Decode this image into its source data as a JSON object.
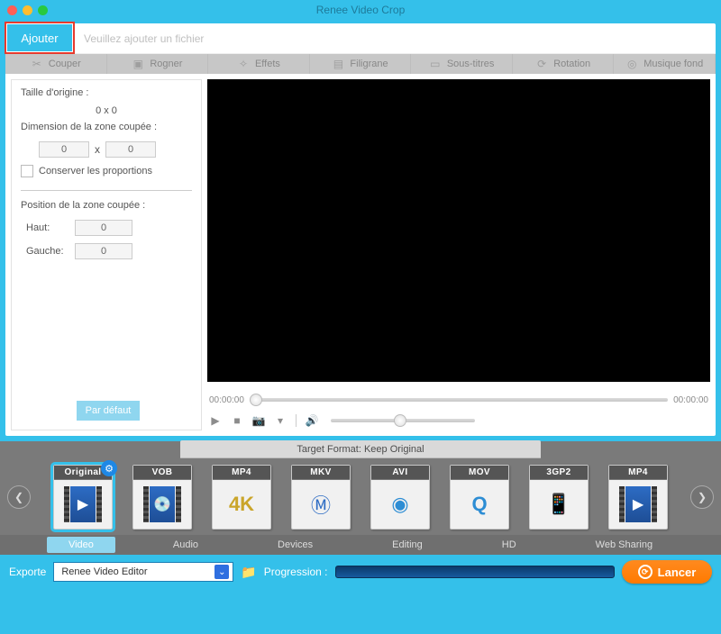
{
  "window": {
    "title": "Renee Video Crop"
  },
  "addbar": {
    "button": "Ajouter",
    "hint": "Veuillez ajouter un fichier"
  },
  "tabs": [
    {
      "label": "Couper",
      "icon": "scissors-icon"
    },
    {
      "label": "Rogner",
      "icon": "crop-icon"
    },
    {
      "label": "Effets",
      "icon": "wand-icon"
    },
    {
      "label": "Filigrane",
      "icon": "stamp-icon"
    },
    {
      "label": "Sous-titres",
      "icon": "subtitle-icon"
    },
    {
      "label": "Rotation",
      "icon": "rotate-icon"
    },
    {
      "label": "Musique fond",
      "icon": "music-icon"
    }
  ],
  "panel": {
    "origLabel": "Taille d'origine :",
    "origValue": "0 x 0",
    "cropDimLabel": "Dimension de la zone coupée :",
    "cropW": "0",
    "x": "x",
    "cropH": "0",
    "keepAspect": "Conserver les proportions",
    "posLabel": "Position de la zone coupée :",
    "topLabel": "Haut:",
    "topVal": "0",
    "leftLabel": "Gauche:",
    "leftVal": "0",
    "defaultBtn": "Par défaut"
  },
  "timeline": {
    "start": "00:00:00",
    "end": "00:00:00"
  },
  "target": {
    "heading": "Target Format: Keep Original"
  },
  "formats": [
    {
      "badge": "Original",
      "selected": true,
      "gear": true
    },
    {
      "badge": "VOB"
    },
    {
      "badge": "MP4",
      "sub": "4K"
    },
    {
      "badge": "MKV",
      "sub": "ⓜ"
    },
    {
      "badge": "AVI",
      "sub": "◐"
    },
    {
      "badge": "MOV",
      "sub": "Q"
    },
    {
      "badge": "3GP2",
      "sub": "📱"
    },
    {
      "badge": "MP4"
    }
  ],
  "categories": [
    "Video",
    "Audio",
    "Devices",
    "Editing",
    "HD",
    "Web Sharing"
  ],
  "activeCategory": 0,
  "bottom": {
    "exportLabel": "Exporte",
    "exportValue": "Renee Video Editor",
    "progLabel": "Progression :",
    "launch": "Lancer"
  }
}
